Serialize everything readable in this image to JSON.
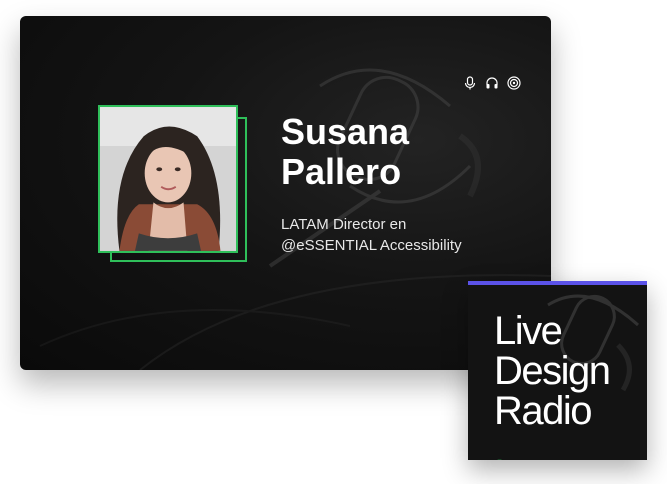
{
  "speaker": {
    "name_line1": "Susana",
    "name_line2": "Pallero",
    "role_line1": "LATAM Director en",
    "role_line2": "@eSSENTIAL Accessibility",
    "photo_alt": "Susana Pallero"
  },
  "icons": [
    "microphone-icon",
    "headphones-icon",
    "podcast-icon"
  ],
  "radio": {
    "line1": "Live",
    "line2": "Design",
    "line3": "Radio",
    "dot": "."
  },
  "colors": {
    "accent_green": "#2fbf5a",
    "accent_purple": "#5b52e8",
    "card_background": "#141414"
  }
}
